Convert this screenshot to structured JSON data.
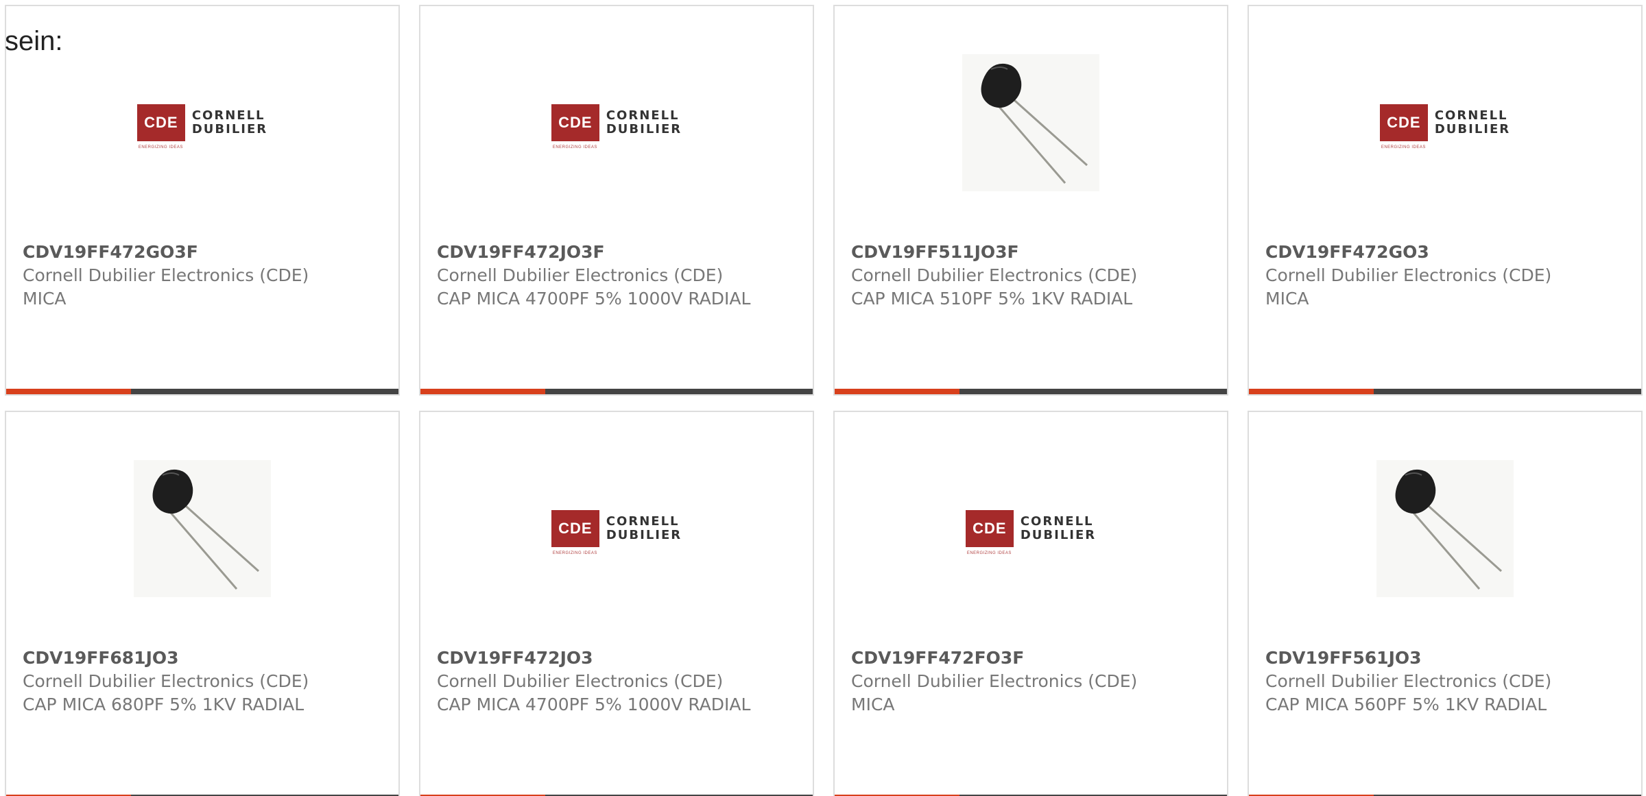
{
  "intro_text": "sein:",
  "logo": {
    "mark": "CDE",
    "line1": "CORNELL",
    "line2": "DUBILIER",
    "tagline": "ENERGIZING IDEAS"
  },
  "colors": {
    "accent": "#d8401c",
    "bar": "#444444",
    "logo_red": "#a52a2a",
    "border": "#dddddd"
  },
  "products": [
    {
      "part": "CDV19FF472GO3F",
      "manufacturer": "Cornell Dubilier Electronics (CDE)",
      "description": "MICA",
      "image": "cde-logo"
    },
    {
      "part": "CDV19FF472JO3F",
      "manufacturer": "Cornell Dubilier Electronics (CDE)",
      "description": "CAP MICA 4700PF 5% 1000V RADIAL",
      "image": "cde-logo"
    },
    {
      "part": "CDV19FF511JO3F",
      "manufacturer": "Cornell Dubilier Electronics (CDE)",
      "description": "CAP MICA 510PF 5% 1KV RADIAL",
      "image": "capacitor-photo"
    },
    {
      "part": "CDV19FF472GO3",
      "manufacturer": "Cornell Dubilier Electronics (CDE)",
      "description": "MICA",
      "image": "cde-logo"
    },
    {
      "part": "CDV19FF681JO3",
      "manufacturer": "Cornell Dubilier Electronics (CDE)",
      "description": "CAP MICA 680PF 5% 1KV RADIAL",
      "image": "capacitor-photo"
    },
    {
      "part": "CDV19FF472JO3",
      "manufacturer": "Cornell Dubilier Electronics (CDE)",
      "description": "CAP MICA 4700PF 5% 1000V RADIAL",
      "image": "cde-logo"
    },
    {
      "part": "CDV19FF472FO3F",
      "manufacturer": "Cornell Dubilier Electronics (CDE)",
      "description": "MICA",
      "image": "cde-logo"
    },
    {
      "part": "CDV19FF561JO3",
      "manufacturer": "Cornell Dubilier Electronics (CDE)",
      "description": "CAP MICA 560PF 5% 1KV RADIAL",
      "image": "capacitor-photo"
    }
  ]
}
